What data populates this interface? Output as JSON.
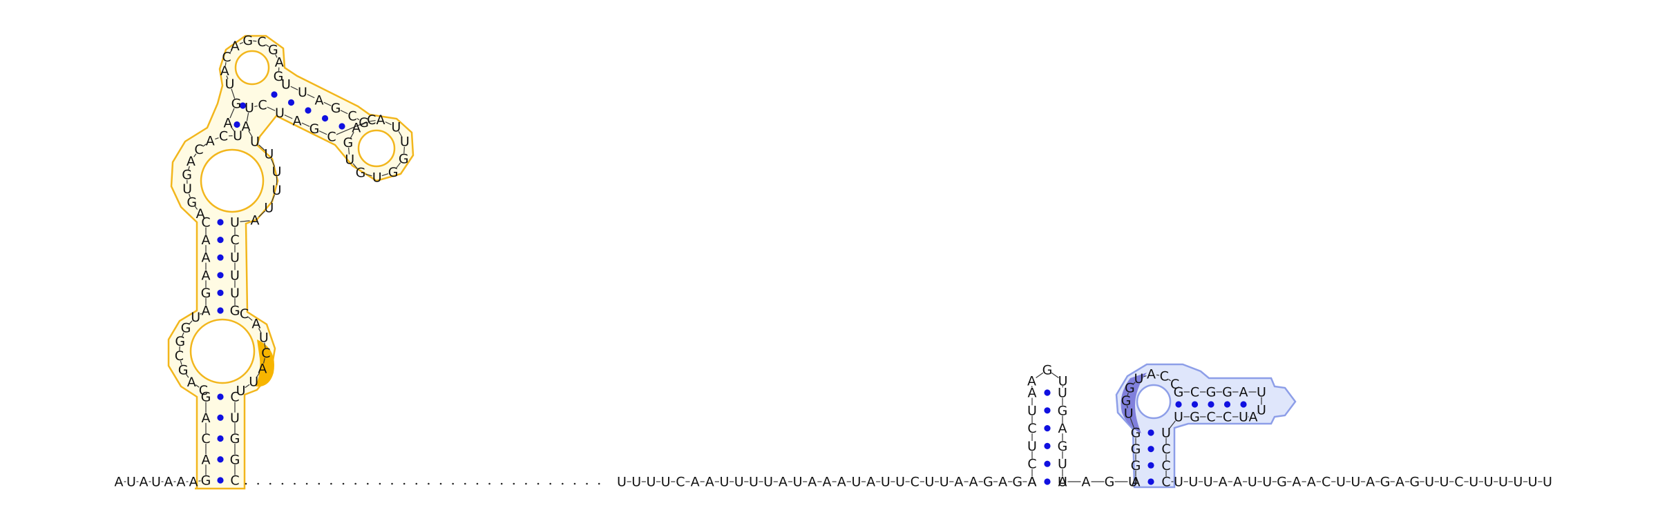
{
  "structure": {
    "five_prime_tail": "AUAUAAA",
    "helix1": {
      "left": "GACAG",
      "right": "CUGGC"
    },
    "internal_loop1": {
      "left": "CAGCGGU",
      "right": "CAUCAUU"
    },
    "helix2": {
      "left": "AGAAAC",
      "right": "UCUUUG"
    },
    "multiloop_left": "AGUGACACU",
    "multiloop_right": "UUUUUA",
    "helix3": {
      "left": "AG",
      "right": "UA"
    },
    "loop3_left": "UACAGCGAG",
    "helix4": {
      "left": "UUAGC",
      "right": "CGAUC"
    },
    "hairpin4": "GAUUGGUGUGAC",
    "connector_unpaired": ".-.-.-.-.-.-.-.-.-.-.-.-.-.-.-.-.-.-.-.-.-.-.-.-.-.-.-.-.-.-",
    "middle_run": "UUUUCAAUUUUAUAAAUAUUCUUAAGAGA",
    "hairpin_small": {
      "left": "ACUCUA",
      "loop": "AGU",
      "right": "UGAGUU"
    },
    "run2": "AAGU",
    "pk_stem": {
      "left": "AGGG",
      "right": "UCCC"
    },
    "pk_loop": "UGGUACC",
    "pk_helix": {
      "left": "GCGGA",
      "right": "UCCGU"
    },
    "pk_hairpin": "UU",
    "pk_hairpin_after": "A",
    "three_prime_tail": "UUUAAUUGAACUUAGAGUUCUUUUUU"
  },
  "highlights": [
    {
      "name": "orange-region",
      "color": "#f2b61c",
      "fill": "#fffbe3",
      "strong": "#f7b500"
    },
    {
      "name": "blue-region",
      "color": "#8d9ee8",
      "fill": "#dfe6fb",
      "strong": "#8080dc"
    }
  ],
  "colors": {
    "base_pair": "#1010e0",
    "text": "#111111"
  }
}
